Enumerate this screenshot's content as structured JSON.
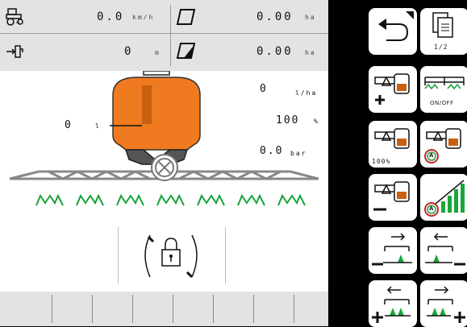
{
  "status": {
    "speed": {
      "value": "0.0",
      "unit": "km/h"
    },
    "distance": {
      "value": "0",
      "unit": "m"
    },
    "area_total": {
      "value": "0.00",
      "unit": "ha"
    },
    "area_part": {
      "value": "0.00",
      "unit": "ha"
    }
  },
  "readouts": {
    "rate": {
      "value": "0",
      "unit": "l/ha"
    },
    "rate_percent": {
      "value": "100",
      "unit": "%"
    },
    "pressure": {
      "value": "0.0",
      "unit": "bar"
    },
    "tank_volume": {
      "value": "0",
      "unit": "l"
    }
  },
  "nozzle_sections": 7,
  "softkeys": {
    "page_indicator": "1/2",
    "on_off_label": "ON/OFF",
    "percent_label": "100%",
    "auto_label": "A"
  },
  "colors": {
    "tank": "#ef7a1f",
    "tank_dark": "#c95f10",
    "nozzle": "#16a33a",
    "active": "#1aa53a"
  }
}
